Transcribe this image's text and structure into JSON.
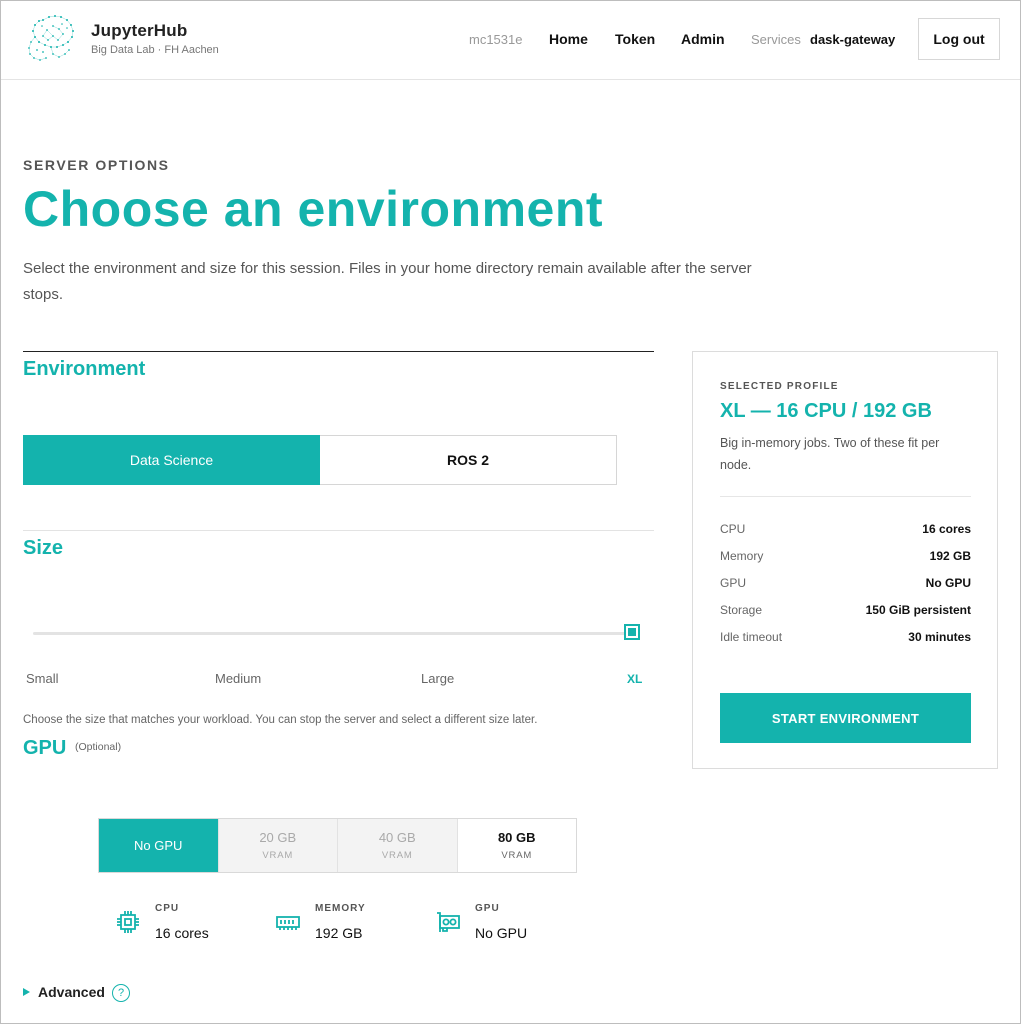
{
  "header": {
    "brand_title": "JupyterHub",
    "brand_subtitle": "Big Data Lab · FH Aachen",
    "user": "mc1531e",
    "nav_home": "Home",
    "nav_token": "Token",
    "nav_admin": "Admin",
    "nav_services": "Services",
    "nav_service_item": "dask-gateway",
    "logout": "Log out"
  },
  "hero": {
    "eyebrow": "SERVER OPTIONS",
    "title": "Choose an environment",
    "lead": "Select the environment and size for this session. Files in your home directory remain available after the server stops."
  },
  "environment": {
    "heading": "Environment",
    "options": [
      "Data Science",
      "ROS 2"
    ],
    "selected": "Data Science"
  },
  "size": {
    "heading": "Size",
    "ticks": [
      "Small",
      "Medium",
      "Large",
      "XL"
    ],
    "selected": "XL",
    "hint": "Choose the size that matches your workload. You can stop the server and select a different size later."
  },
  "gpu": {
    "heading": "GPU",
    "optional": "(Optional)",
    "options": [
      {
        "label": "No GPU",
        "unit": ""
      },
      {
        "label": "20 GB",
        "unit": "VRAM"
      },
      {
        "label": "40 GB",
        "unit": "VRAM"
      },
      {
        "label": "80 GB",
        "unit": "VRAM"
      }
    ],
    "selected": "No GPU"
  },
  "summary": {
    "cpu_label": "CPU",
    "cpu_value": "16 cores",
    "memory_label": "MEMORY",
    "memory_value": "192 GB",
    "gpu_label": "GPU",
    "gpu_value": "No GPU"
  },
  "advanced": {
    "label": "Advanced",
    "help": "?"
  },
  "card": {
    "eyebrow": "SELECTED PROFILE",
    "title": "XL — 16 CPU / 192 GB",
    "description": "Big in-memory jobs. Two of these fit per node.",
    "rows": [
      {
        "key": "CPU",
        "value": "16 cores"
      },
      {
        "key": "Memory",
        "value": "192 GB"
      },
      {
        "key": "GPU",
        "value": "No GPU"
      },
      {
        "key": "Storage",
        "value": "150 GiB persistent"
      },
      {
        "key": "Idle timeout",
        "value": "30 minutes"
      }
    ],
    "start_button": "START ENVIRONMENT"
  },
  "colors": {
    "accent": "#14b3ad",
    "text": "#222222",
    "muted": "#666666",
    "border": "#d9d9d9"
  },
  "icons": {
    "logo": "dotted-elephant-logo",
    "cpu": "cpu-chip-icon",
    "memory": "memory-stick-icon",
    "gpu": "gpu-card-icon",
    "advanced": "triangle-right-icon",
    "help": "help-circle-icon"
  }
}
